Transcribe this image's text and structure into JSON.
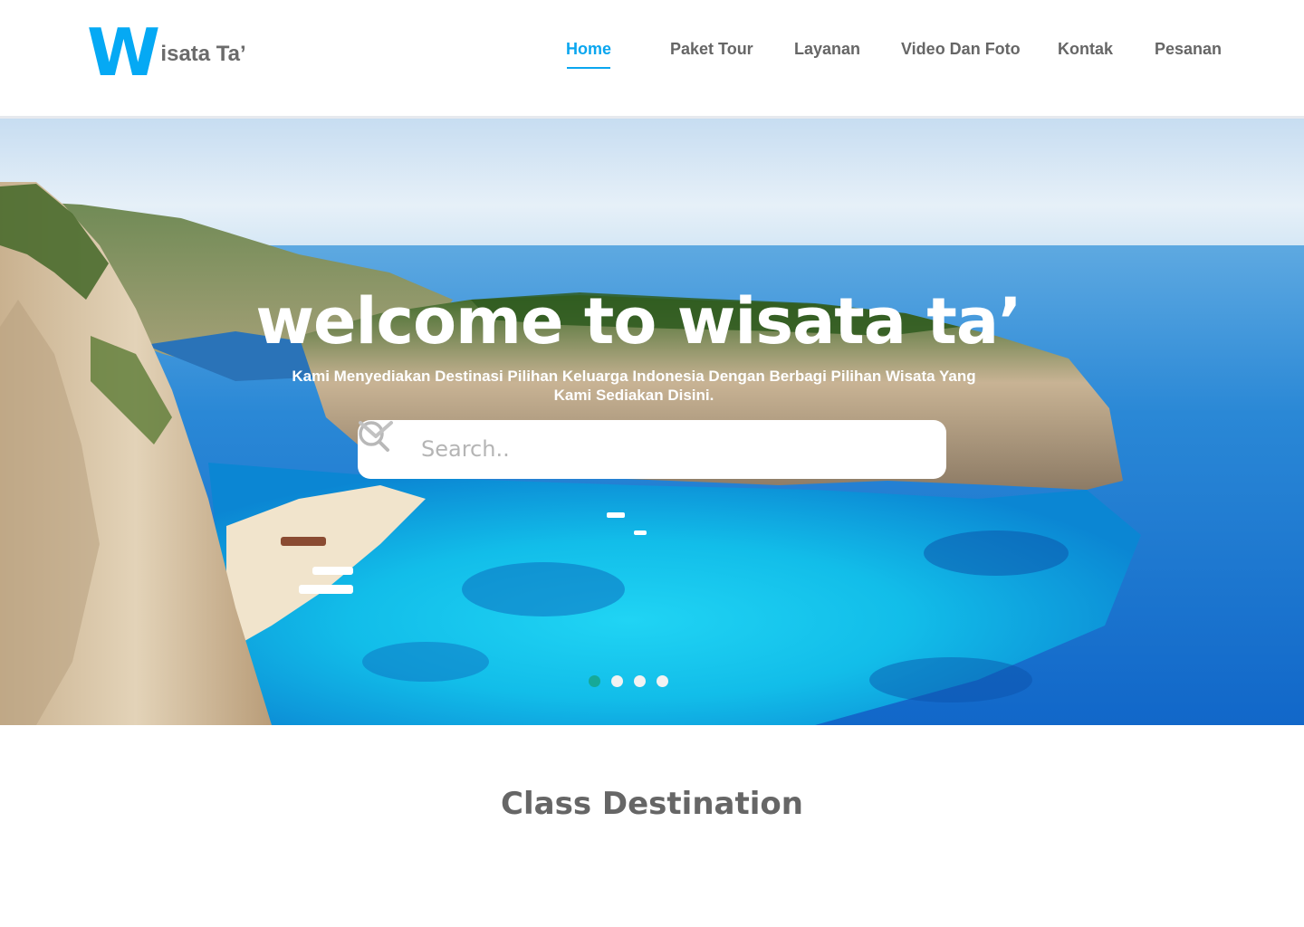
{
  "brand": {
    "initial": "W",
    "name": "isata Ta’"
  },
  "nav": {
    "items": [
      {
        "label": "Home",
        "active": true
      },
      {
        "label": "Paket Tour",
        "active": false
      },
      {
        "label": "Layanan",
        "active": false
      },
      {
        "label": "Video Dan Foto",
        "active": false
      },
      {
        "label": "Kontak",
        "active": false
      },
      {
        "label": "Pesanan",
        "active": false
      }
    ]
  },
  "hero": {
    "title": "welcome to wisata ta’",
    "subtitle": "Kami Menyediakan Destinasi Pilihan Keluarga Indonesia Dengan Berbagi Pilihan Wisata Yang Kami Sediakan Disini.",
    "search": {
      "placeholder": "Search..",
      "value": ""
    },
    "carousel": {
      "slide_count": 4,
      "active_index": 0
    }
  },
  "section": {
    "title": "Class Destination"
  },
  "colors": {
    "accent": "#0aa6ef",
    "text_gray": "#666666",
    "active_dot": "#16a58a"
  }
}
